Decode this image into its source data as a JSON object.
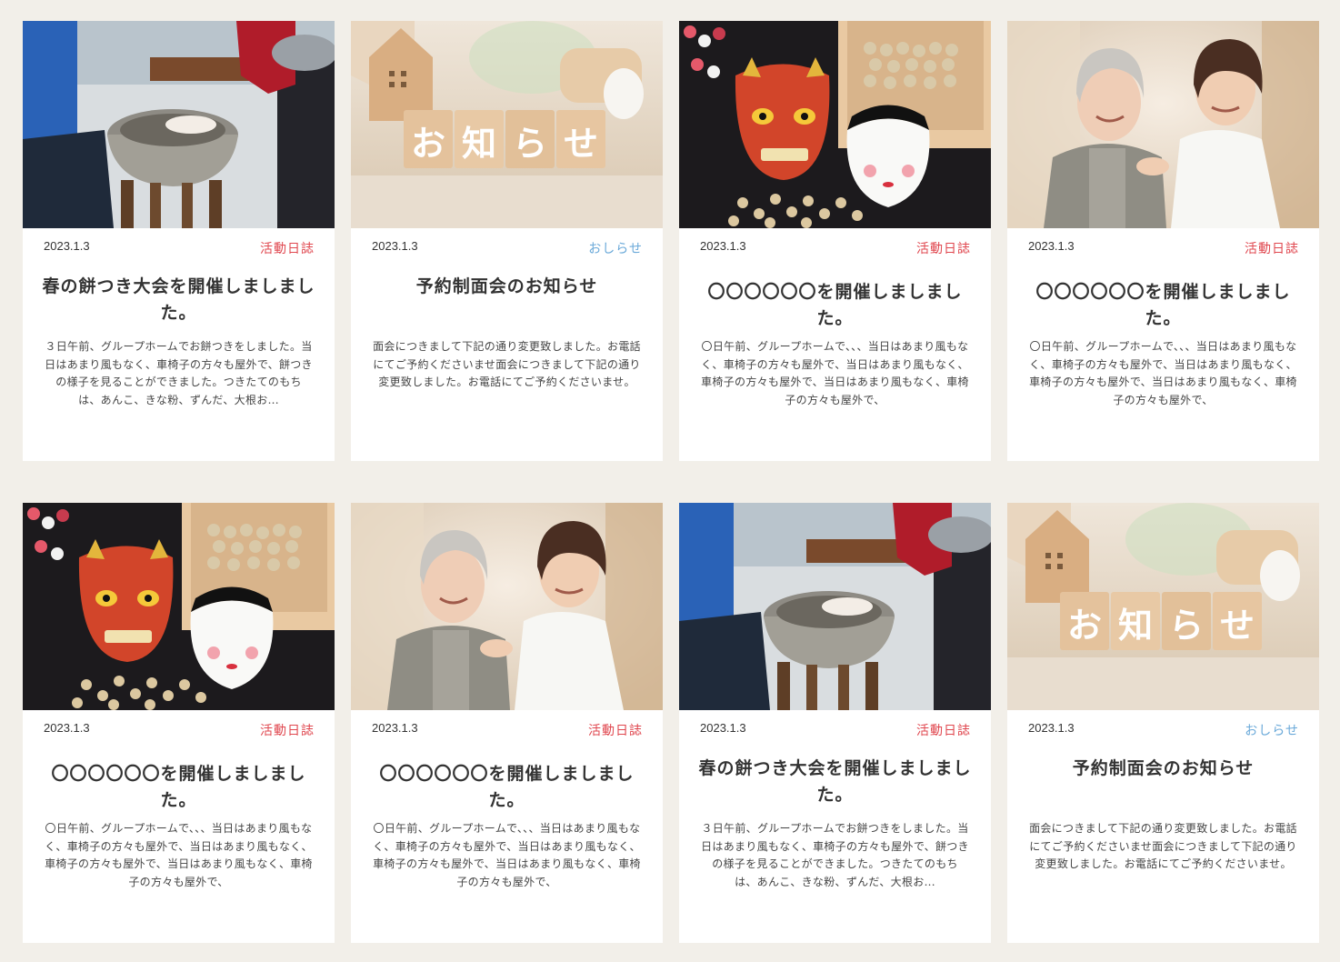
{
  "colors": {
    "background": "#f2efe9",
    "activity": "#e0474f",
    "news": "#6aa9d9",
    "text": "#333333"
  },
  "cards": [
    {
      "image": "mochi-pounding-photo",
      "date": "2023.1.3",
      "category": "活動日誌",
      "title": "春の餅つき大会を開催しましました。",
      "excerpt": "３日午前、グループホームでお餅つきをしました。当日はあまり風もなく、車椅子の方々も屋外で、餅つきの様子を見ることができました。つきたてのもちは、あんこ、きな粉、ずんだ、大根お..."
    },
    {
      "image": "oshirase-blocks-photo",
      "date": "2023.1.3",
      "category": "おしらせ",
      "title": "予約制面会のお知らせ",
      "excerpt": "面会につきまして下記の通り変更致しました。お電話にてご予約くださいませ面会につきまして下記の通り変更致しました。お電話にてご予約くださいませ。"
    },
    {
      "image": "setsubun-oni-mask-photo",
      "date": "2023.1.3",
      "category": "活動日誌",
      "title": "〇〇〇〇〇〇を開催しましました。",
      "excerpt": "〇日午前、グループホームで、、、当日はあまり風もなく、車椅子の方々も屋外で、当日はあまり風もなく、車椅子の方々も屋外で、当日はあまり風もなく、車椅子の方々も屋外で、"
    },
    {
      "image": "caregiver-elderly-photo",
      "date": "2023.1.3",
      "category": "活動日誌",
      "title": "〇〇〇〇〇〇を開催しましました。",
      "excerpt": "〇日午前、グループホームで、、、当日はあまり風もなく、車椅子の方々も屋外で、当日はあまり風もなく、車椅子の方々も屋外で、当日はあまり風もなく、車椅子の方々も屋外で、"
    },
    {
      "image": "setsubun-oni-mask-photo",
      "date": "2023.1.3",
      "category": "活動日誌",
      "title": "〇〇〇〇〇〇を開催しましました。",
      "excerpt": "〇日午前、グループホームで、、、当日はあまり風もなく、車椅子の方々も屋外で、当日はあまり風もなく、車椅子の方々も屋外で、当日はあまり風もなく、車椅子の方々も屋外で、"
    },
    {
      "image": "caregiver-elderly-photo",
      "date": "2023.1.3",
      "category": "活動日誌",
      "title": "〇〇〇〇〇〇を開催しましました。",
      "excerpt": "〇日午前、グループホームで、、、当日はあまり風もなく、車椅子の方々も屋外で、当日はあまり風もなく、車椅子の方々も屋外で、当日はあまり風もなく、車椅子の方々も屋外で、"
    },
    {
      "image": "mochi-pounding-photo",
      "date": "2023.1.3",
      "category": "活動日誌",
      "title": "春の餅つき大会を開催しましました。",
      "excerpt": "３日午前、グループホームでお餅つきをしました。当日はあまり風もなく、車椅子の方々も屋外で、餅つきの様子を見ることができました。つきたてのもちは、あんこ、きな粉、ずんだ、大根お..."
    },
    {
      "image": "oshirase-blocks-photo",
      "date": "2023.1.3",
      "category": "おしらせ",
      "title": "予約制面会のお知らせ",
      "excerpt": "面会につきまして下記の通り変更致しました。お電話にてご予約くださいませ面会につきまして下記の通り変更致しました。お電話にてご予約くださいませ。"
    }
  ],
  "block_letters": [
    "お",
    "知",
    "ら",
    "せ"
  ]
}
